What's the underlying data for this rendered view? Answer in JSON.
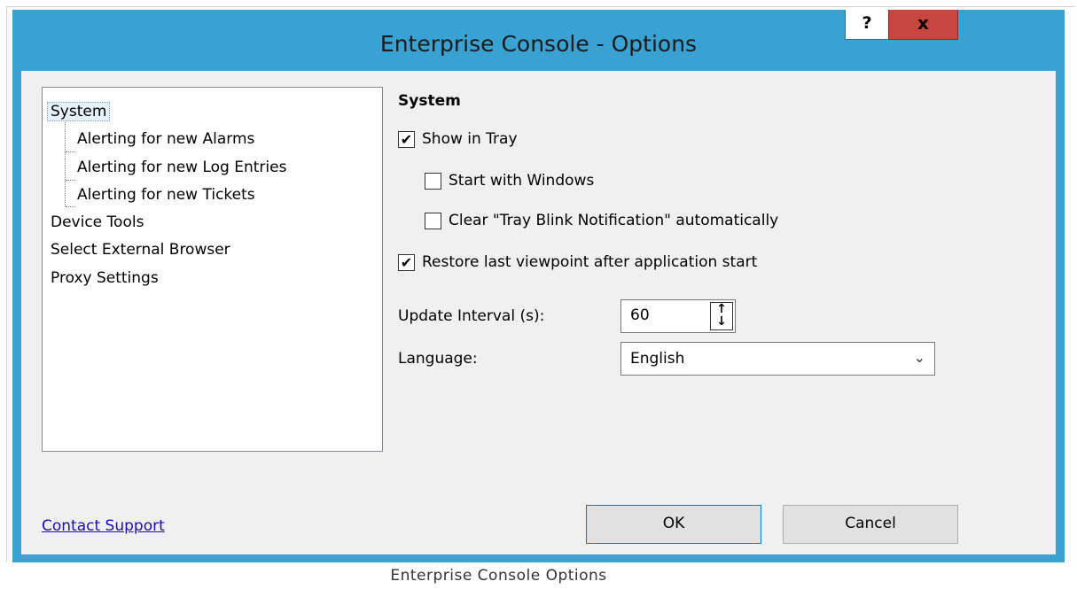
{
  "window": {
    "title": "Enterprise Console - Options",
    "help_label": "?",
    "close_label": "x"
  },
  "tree": {
    "items": [
      {
        "label": "System",
        "level": 0,
        "selected": true
      },
      {
        "label": "Alerting for new Alarms",
        "level": 1
      },
      {
        "label": "Alerting for new Log Entries",
        "level": 1
      },
      {
        "label": "Alerting for new Tickets",
        "level": 1
      },
      {
        "label": "Device Tools",
        "level": 0
      },
      {
        "label": "Select External Browser",
        "level": 0
      },
      {
        "label": "Proxy Settings",
        "level": 0
      }
    ]
  },
  "panel": {
    "section_title": "System",
    "show_in_tray": {
      "label": "Show in Tray",
      "checked": true
    },
    "start_with_windows": {
      "label": "Start with Windows",
      "checked": false
    },
    "clear_tray_blink": {
      "label": "Clear \"Tray Blink Notification\" automatically",
      "checked": false
    },
    "restore_viewpoint": {
      "label": "Restore last viewpoint after application start",
      "checked": true
    },
    "update_interval": {
      "label": "Update Interval (s):",
      "value": "60"
    },
    "language": {
      "label": "Language:",
      "value": "English"
    }
  },
  "footer": {
    "contact_support": "Contact Support",
    "ok_label": "OK",
    "cancel_label": "Cancel"
  },
  "caption": "Enterprise Console Options",
  "colors": {
    "titlebar": "#3aa1d3",
    "close_button": "#c7463f",
    "dialog_bg": "#f0f0f0",
    "link": "#1a0dab"
  }
}
